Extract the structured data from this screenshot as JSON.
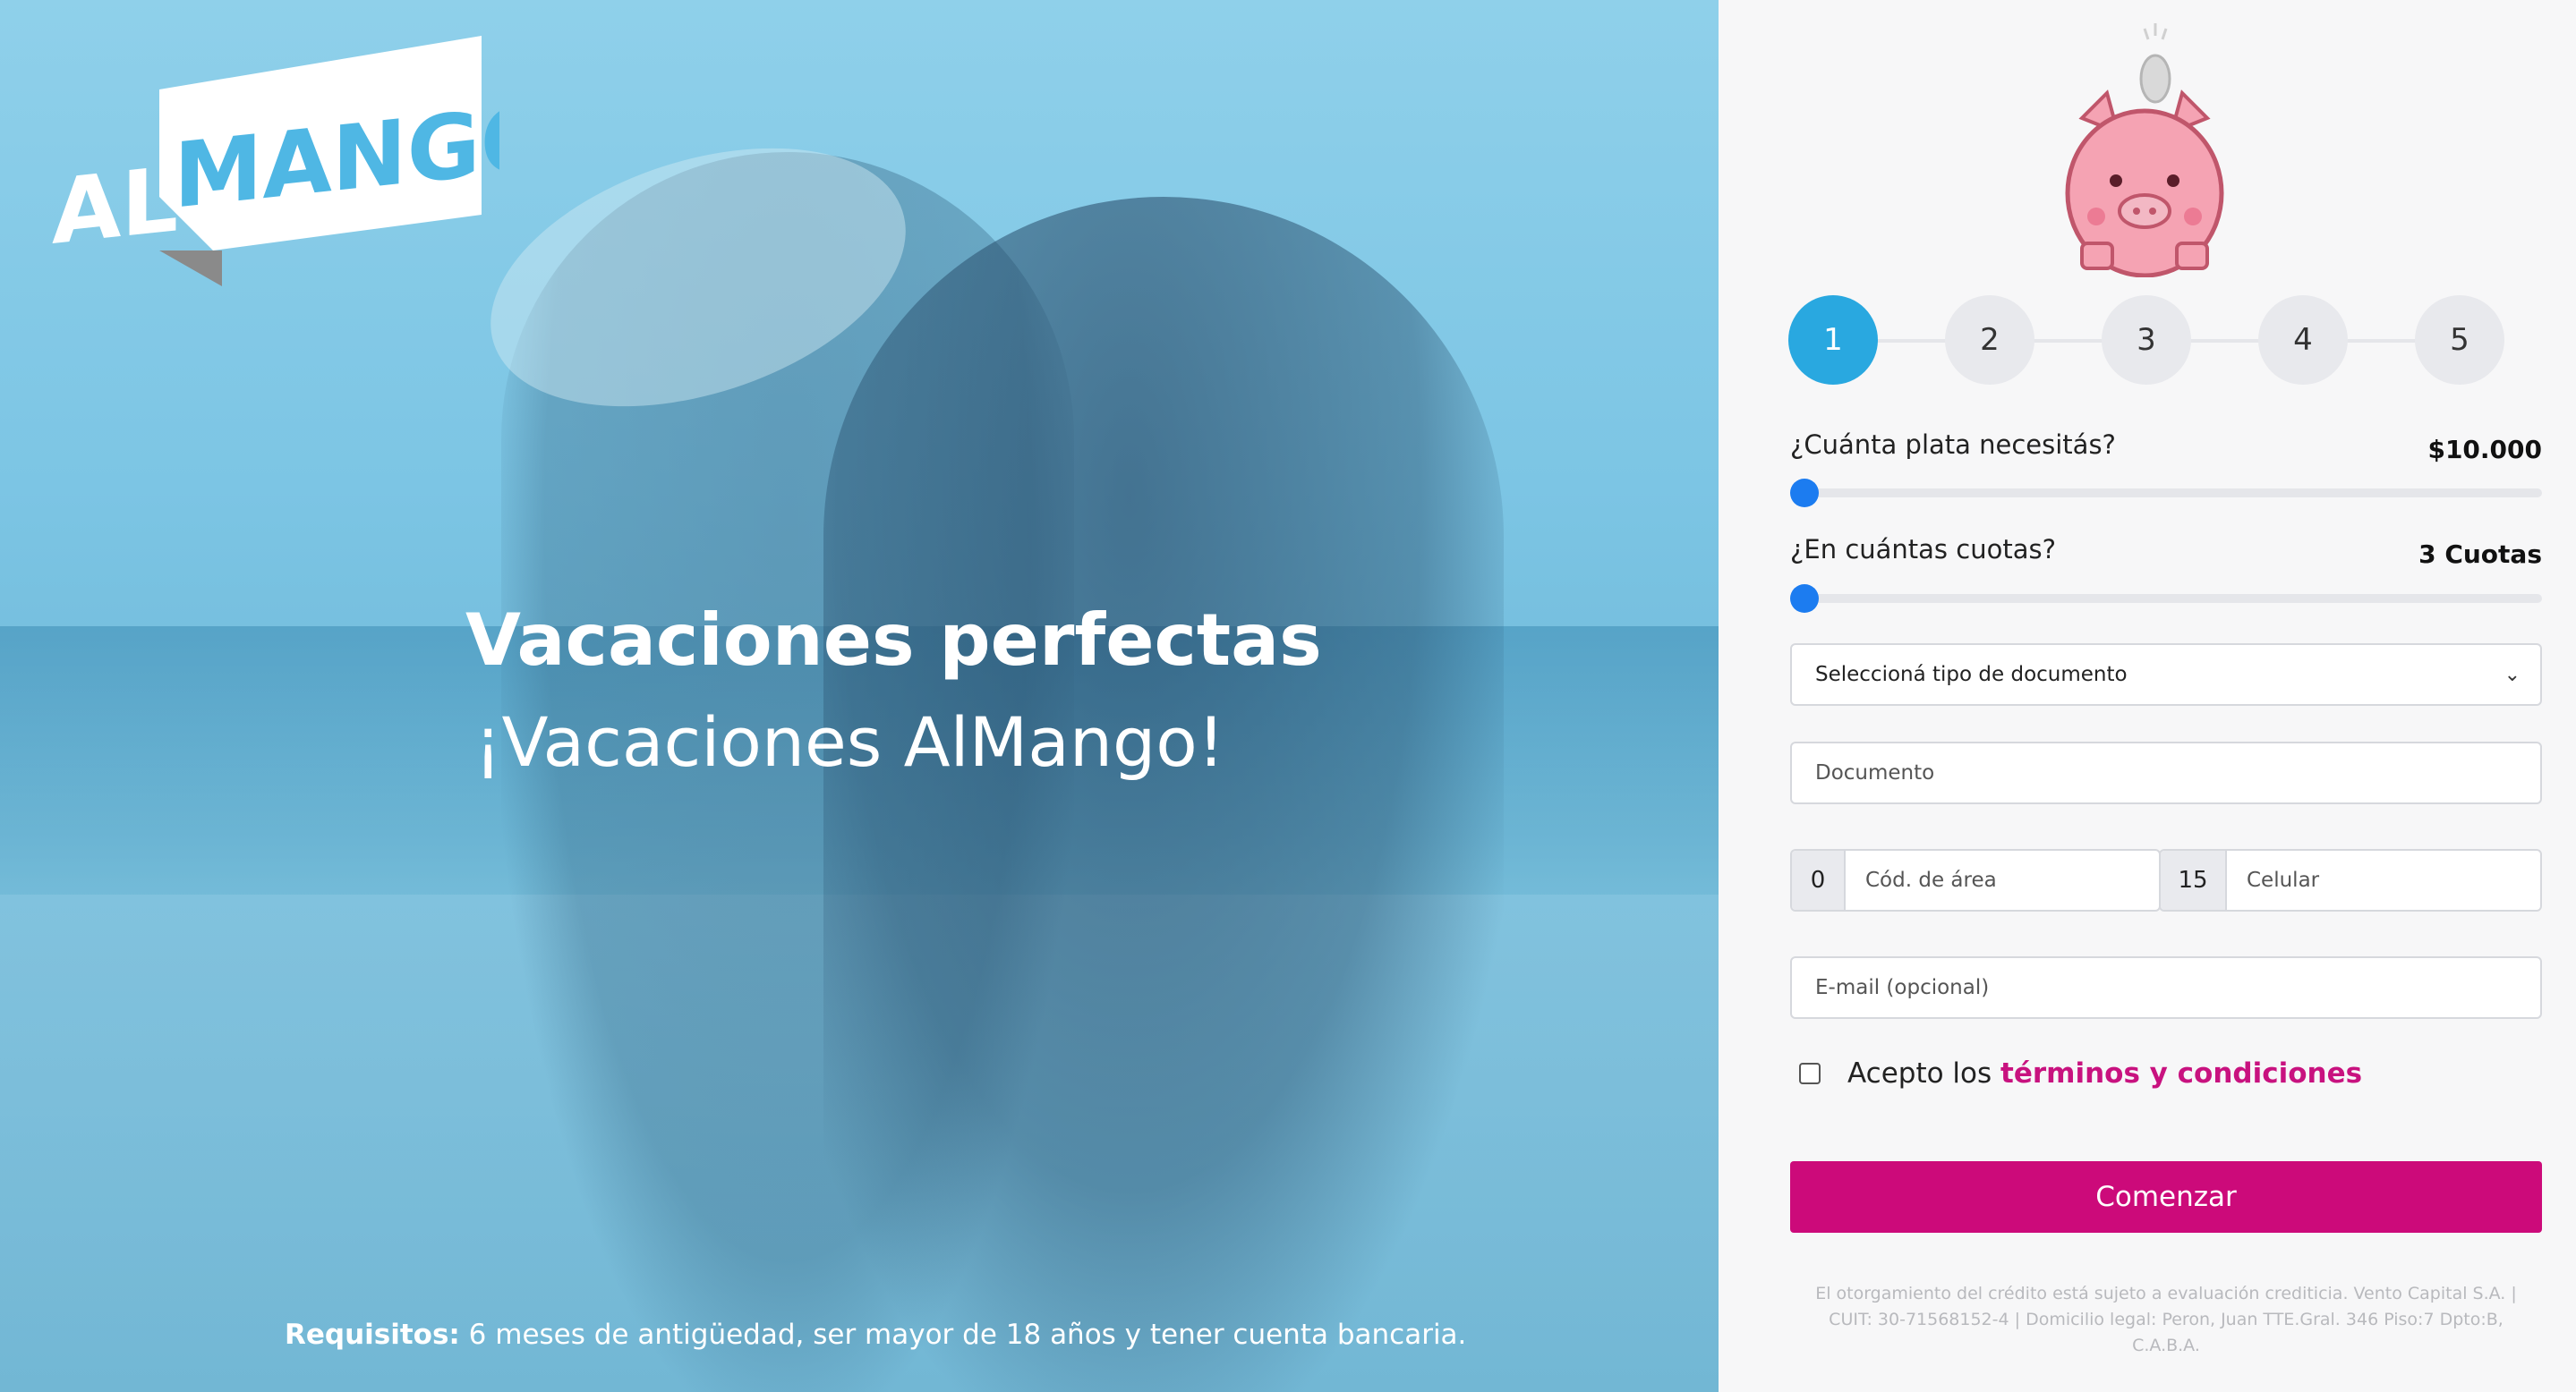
{
  "brand": {
    "logo_al": "AL",
    "logo_mango": "MANGO",
    "colors": {
      "primary": "#cc0a7a",
      "accent": "#29a8e0",
      "slider": "#1c7cf0"
    }
  },
  "hero": {
    "title": "Vacaciones perfectas",
    "subtitle": "¡Vacaciones AlMango!",
    "requirements_label": "Requisitos:",
    "requirements_text": " 6 meses de antigüedad, ser mayor de 18 años y tener cuenta bancaria."
  },
  "steps": [
    "1",
    "2",
    "3",
    "4",
    "5"
  ],
  "active_step": 1,
  "amount": {
    "label": "¿Cuánta plata necesitás?",
    "value": "$10.000",
    "level": 0
  },
  "installments": {
    "label": "¿En cuántas cuotas?",
    "value": "3 Cuotas",
    "level": 0
  },
  "form": {
    "document_type_placeholder": "Seleccioná tipo de documento",
    "document_placeholder": "Documento",
    "area_prefix": "0",
    "area_placeholder": "Cód. de área",
    "phone_prefix": "15",
    "phone_placeholder": "Celular",
    "email_placeholder": "E-mail (opcional)"
  },
  "terms": {
    "prefix": "Acepto los ",
    "link": "términos y condiciones"
  },
  "cta": {
    "label": "Comenzar"
  },
  "legal": {
    "line1": "El otorgamiento del crédito está sujeto a evaluación crediticia. Vento Capital S.A. |",
    "line2": "CUIT: 30-71568152-4 | Domicilio legal: Peron, Juan TTE.Gral. 346 Piso:7 Dpto:B,",
    "line3": "C.A.B.A."
  },
  "icons": {
    "logo": "almango-logo",
    "piggy": "piggy-bank-icon",
    "chevron": "chevron-down-icon"
  }
}
